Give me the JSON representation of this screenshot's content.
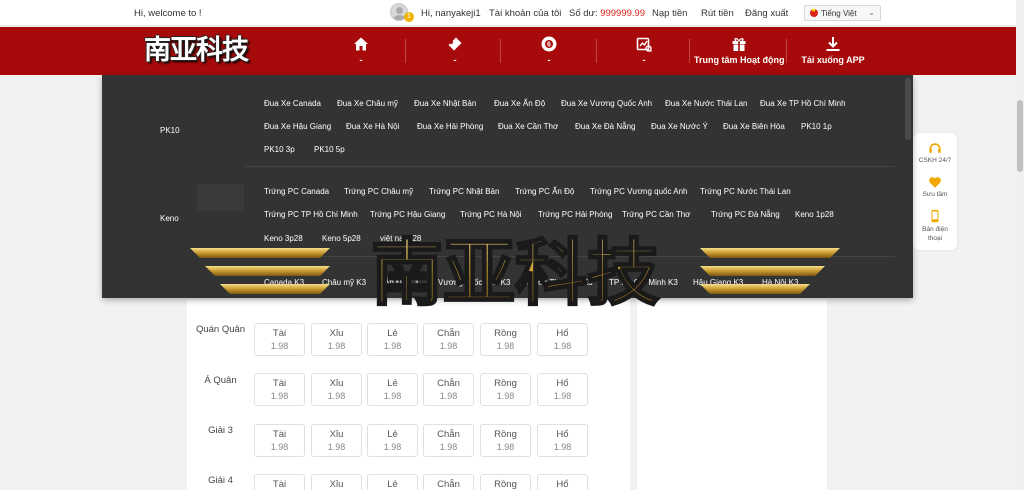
{
  "topbar": {
    "welcome": "Hi, welcome to !",
    "avatar_badge": "1",
    "username": "Hi, nanyakeji1",
    "account": "Tài khoản của tôi",
    "balance_label": "Số dư:",
    "balance_value": "999999.99",
    "deposit": "Nạp tiền",
    "withdraw": "Rút tiền",
    "logout": "Đăng xuất",
    "language": "Tiếng Việt"
  },
  "logo": {
    "text": "南亚科技"
  },
  "nav": [
    {
      "label": "-",
      "icon": "home-icon"
    },
    {
      "label": "-",
      "icon": "ticket-icon"
    },
    {
      "label": "-",
      "icon": "lottery-ball-icon"
    },
    {
      "label": "-",
      "icon": "chart-icon"
    },
    {
      "label": "Trung tâm Hoạt động",
      "icon": "gift-icon"
    },
    {
      "label": "Tải xuống APP",
      "icon": "download-icon"
    }
  ],
  "dropdown": {
    "categories": [
      {
        "name": "PK10",
        "rows": [
          [
            "Đua Xe Canada",
            "Đua Xe Châu mỹ",
            "Đua Xe Nhật Bản",
            "Đua Xe Ấn Độ",
            "Đua Xe Vương Quốc Anh",
            "Đua Xe Nước Thái Lan",
            "Đua Xe TP Hồ Chí Minh"
          ],
          [
            "Đua Xe Hậu Giang",
            "Đua Xe Hà Nội",
            "Đua Xe Hải Phòng",
            "Đua Xe Cần Thơ",
            "Đua Xe Đà Nẵng",
            "Đua Xe Nước Ý",
            "Đua Xe Biên Hòa",
            "PK10 1p"
          ],
          [
            "PK10 3p",
            "PK10 5p"
          ]
        ]
      },
      {
        "name": "Keno",
        "rows": [
          [
            "Trứng PC Canada",
            "Trứng PC Châu mỹ",
            "Trứng PC Nhật Bản",
            "Trứng PC Ấn Độ",
            "Trứng PC Vương quốc Anh",
            "Trứng PC Nước Thái Lan"
          ],
          [
            "Trứng PC TP Hồ Chí Minh",
            "Trứng PC Hậu Giang",
            "Trứng PC Hà Nội",
            "Trứng PC Hải Phòng",
            "Trứng PC Cần Thơ",
            "Trứng PC Đà Nẵng",
            "Keno 1p28"
          ],
          [
            "Keno 3p28",
            "Keno 5p28",
            "việt nam 28"
          ]
        ]
      },
      {
        "name": "",
        "rows": [
          [
            "Canada K3",
            "Châu mỹ K3",
            "Ấn Độ K3",
            "Vương quốc Anh K3",
            "Nước Thái Lan K3",
            "TP Hồ Chí Minh K3",
            "Hậu Giang K3",
            "Hà Nội K3"
          ]
        ]
      }
    ]
  },
  "watermark": "南亚科技",
  "bet_board": {
    "options": [
      "Tài",
      "Xỉu",
      "Lẻ",
      "Chẵn",
      "Rồng",
      "Hổ"
    ],
    "rows": [
      {
        "label": "Quán Quân",
        "odds": [
          "1.98",
          "1.98",
          "1.98",
          "1.98",
          "1.98",
          "1.98"
        ]
      },
      {
        "label": "Á Quân",
        "odds": [
          "1.98",
          "1.98",
          "1.98",
          "1.98",
          "1.98",
          "1.98"
        ]
      },
      {
        "label": "Giải 3",
        "odds": [
          "1.98",
          "1.98",
          "1.98",
          "1.98",
          "1.98",
          "1.98"
        ]
      },
      {
        "label": "Giải 4",
        "odds": [
          "",
          "",
          "",
          "",
          "",
          ""
        ]
      }
    ]
  },
  "side_tools": [
    {
      "label": "CSKH 24/7",
      "icon": "headset-icon"
    },
    {
      "label": "Sưu tầm",
      "icon": "heart-icon"
    },
    {
      "label": "Bản điện thoại",
      "icon": "phone-icon"
    }
  ]
}
